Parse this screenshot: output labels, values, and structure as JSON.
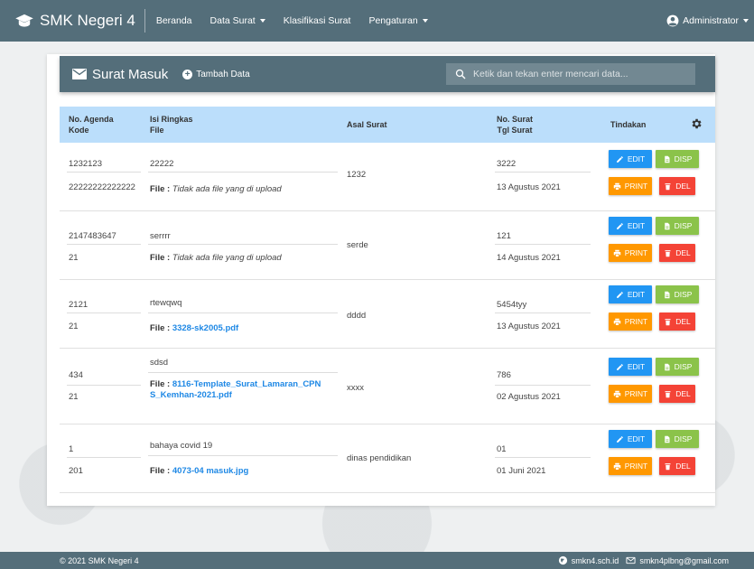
{
  "nav": {
    "brand": "SMK Negeri 4",
    "items": [
      {
        "label": "Beranda",
        "caret": false
      },
      {
        "label": "Data Surat",
        "caret": true
      },
      {
        "label": "Klasifikasi Surat",
        "caret": false
      },
      {
        "label": "Pengaturan",
        "caret": true
      }
    ],
    "user": "Administrator"
  },
  "page": {
    "title": "Surat Masuk",
    "add_label": "Tambah Data",
    "search_placeholder": "Ketik dan tekan enter mencari data..."
  },
  "table": {
    "headers": {
      "agenda": "No. Agenda",
      "kode": "Kode",
      "isi": "Isi Ringkas",
      "file": "File",
      "asal": "Asal Surat",
      "no_surat": "No. Surat",
      "tgl": "Tgl Surat",
      "tindakan": "Tindakan"
    },
    "file_prefix": "File :",
    "rows": [
      {
        "agenda": "1232123",
        "kode": "22222222222222",
        "isi": "22222",
        "file": "Tidak ada file yang di upload",
        "file_is_link": false,
        "asal": "1232",
        "no_surat": "3222",
        "tgl": "13 Agustus 2021"
      },
      {
        "agenda": "2147483647",
        "kode": "21",
        "isi": "serrrr",
        "file": "Tidak ada file yang di upload",
        "file_is_link": false,
        "asal": "serde",
        "no_surat": "121",
        "tgl": "14 Agustus 2021"
      },
      {
        "agenda": "2121",
        "kode": "21",
        "isi": "rtewqwq",
        "file": "3328-sk2005.pdf",
        "file_is_link": true,
        "asal": "dddd",
        "no_surat": "5454tyy",
        "tgl": "13 Agustus 2021"
      },
      {
        "agenda": "434",
        "kode": "21",
        "isi": "sdsd",
        "file": "8116-Template_Surat_Lamaran_CPNS_Kemhan-2021.pdf",
        "file_is_link": true,
        "asal": "xxxx",
        "no_surat": "786",
        "tgl": "02 Agustus 2021"
      },
      {
        "agenda": "1",
        "kode": "201",
        "isi": "bahaya covid 19",
        "file": "4073-04 masuk.jpg",
        "file_is_link": true,
        "asal": "dinas pendidikan",
        "no_surat": "01",
        "tgl": "01 Juni 2021"
      }
    ]
  },
  "actions": {
    "edit": "EDIT",
    "disp": "DISP",
    "print": "PRINT",
    "del": "DEL"
  },
  "footer": {
    "copyright": "© 2021 SMK Negeri 4",
    "website": "smkn4.sch.id",
    "email": "smkn4plbng@gmail.com"
  },
  "colors": {
    "primary": "#546e7a",
    "table_header": "#bbdefb",
    "edit": "#2196f3",
    "disp": "#8bc34a",
    "print": "#ff9800",
    "del": "#f44336",
    "link": "#1e88e5"
  }
}
